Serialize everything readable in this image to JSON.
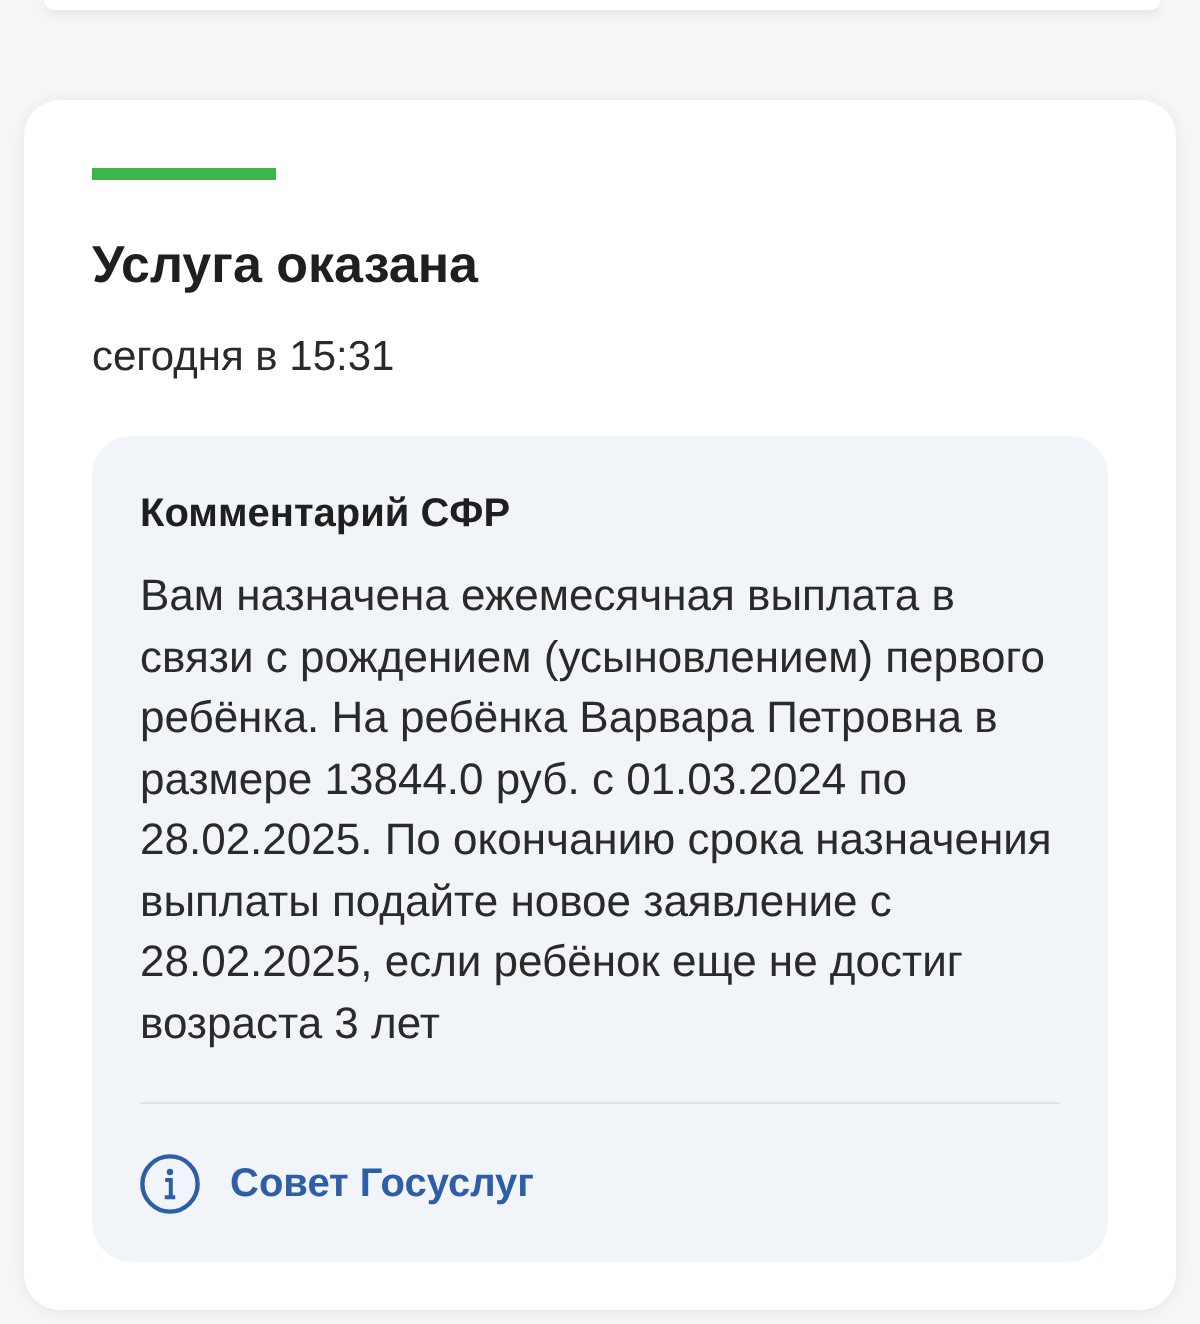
{
  "status": {
    "completed": true,
    "title": "Услуга оказана",
    "time": "сегодня в 15:31"
  },
  "comment": {
    "title": "Комментарий СФР",
    "text": "Вам назначена ежемесячная выплата в связи с рождением (усыновлением) первого ребёнка. На ребёнка Варвара Петровна в размере 13844.0 руб. с 01.03.2024 по 28.02.2025. По окончанию срока назначения выплаты подайте новое заявление с 28.02.2025, если ребёнок еще не достиг возраста 3 лет"
  },
  "advice_link": {
    "label": "Совет Госуслуг"
  }
}
